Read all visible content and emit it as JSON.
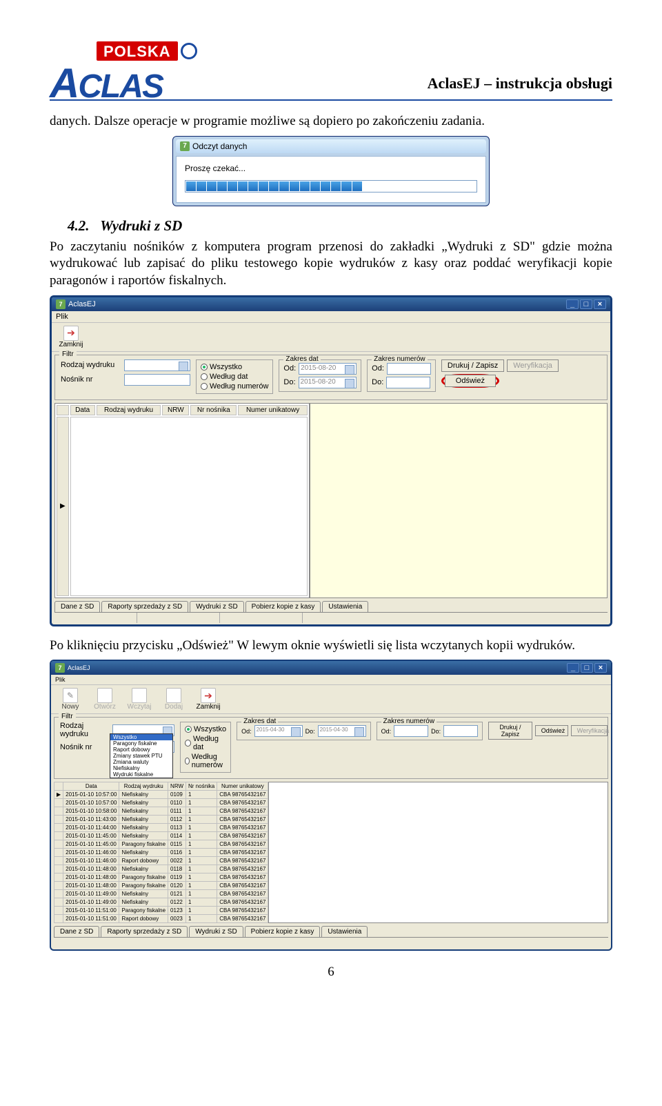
{
  "doc": {
    "header_title": "AclasEJ – instrukcja obsługi",
    "logo_polska": "POLSKA",
    "logo_aclas": "ACLAS",
    "para1": "danych. Dalsze operacje w programie możliwe są dopiero po zakończeniu zadania.",
    "section_no": "4.2.",
    "section_title": "Wydruki z SD",
    "para2": "Po zaczytaniu nośników z komputera program przenosi do zakładki „Wydruki z SD\" gdzie można wydrukować lub zapisać do pliku testowego kopie wydruków z kasy oraz poddać weryfikacji kopie paragonów i raportów fiskalnych.",
    "para3": "Po kliknięciu przycisku „Odśwież\" W lewym oknie wyświetli się lista wczytanych kopii wydruków.",
    "page_number": "6"
  },
  "progress_dialog": {
    "title": "Odczyt danych",
    "wait": "Proszę czekać...",
    "filled_segments": 17,
    "total_segments": 28
  },
  "app1": {
    "title": "AclasEJ",
    "menu_plik": "Plik",
    "tool_zamknij": "Zamknij",
    "filter_legend": "Filtr",
    "rodzaj_label": "Rodzaj wydruku",
    "nosnik_label": "Nośnik nr",
    "radio": {
      "wszystko": "Wszystko",
      "wedlug_dat": "Według dat",
      "wedlug_num": "Według numerów"
    },
    "zakres_dat": "Zakres dat",
    "zakres_num": "Zakres numerów",
    "od": "Od:",
    "do": "Do:",
    "date_from": "2015-08-20",
    "date_to": "2015-08-20",
    "btn_drukuj": "Drukuj / Zapisz",
    "btn_weryf": "Weryfikacja",
    "btn_odswiez": "Odśwież",
    "cols": {
      "data": "Data",
      "rodzaj": "Rodzaj wydruku",
      "nrw": "NRW",
      "nrnos": "Nr nośnika",
      "numunik": "Numer unikatowy"
    },
    "tabs": [
      "Dane z SD",
      "Raporty sprzedaży z SD",
      "Wydruki z SD",
      "Pobierz kopie z kasy",
      "Ustawienia"
    ]
  },
  "app2": {
    "title": "AclasEJ",
    "menu_plik": "Plik",
    "toolbar": {
      "nowy": "Nowy",
      "otworz": "Otwórz",
      "wczytaj": "Wczytaj",
      "dodaj": "Dodaj",
      "zamknij": "Zamknij"
    },
    "filter_legend": "Filtr",
    "rodzaj_label": "Rodzaj wydruku",
    "nosnik_label": "Nośnik nr",
    "radio": {
      "wszystko": "Wszystko",
      "wedlug_dat": "Według dat",
      "wedlug_num": "Według numerów"
    },
    "zakres_dat": "Zakres dat",
    "zakres_num": "Zakres numerów",
    "od": "Od:",
    "do": "Do:",
    "date_from": "2015-04-30",
    "date_to": "2015-04-30",
    "btn_drukuj": "Drukuj / Zapisz",
    "btn_odswiez": "Odśwież",
    "btn_weryf": "Weryfikacja",
    "cols": {
      "data": "Data",
      "rodzaj": "Rodzaj wydruku",
      "nrw": "NRW",
      "nrnos": "Nr nośnika",
      "numunik": "Numer unikatowy"
    },
    "dropdown_options": [
      "Wszystko",
      "Paragony fiskalne",
      "Raport dobowy",
      "Zmiany stawek PTU",
      "Zmiana waluty",
      "Niefiskalny",
      "Wydruki fiskalne"
    ],
    "rows": [
      {
        "data": "2015-01-10 10:57:00",
        "rodzaj": "Niefiskalny",
        "nrw": "0109",
        "nos": "1",
        "unik": "CBA 98765432167"
      },
      {
        "data": "2015-01-10 10:57:00",
        "rodzaj": "Niefiskalny",
        "nrw": "0110",
        "nos": "1",
        "unik": "CBA 98765432167"
      },
      {
        "data": "2015-01-10 10:58:00",
        "rodzaj": "Niefiskalny",
        "nrw": "0111",
        "nos": "1",
        "unik": "CBA 98765432167"
      },
      {
        "data": "2015-01-10 11:43:00",
        "rodzaj": "Niefiskalny",
        "nrw": "0112",
        "nos": "1",
        "unik": "CBA 98765432167"
      },
      {
        "data": "2015-01-10 11:44:00",
        "rodzaj": "Niefiskalny",
        "nrw": "0113",
        "nos": "1",
        "unik": "CBA 98765432167"
      },
      {
        "data": "2015-01-10 11:45:00",
        "rodzaj": "Niefiskalny",
        "nrw": "0114",
        "nos": "1",
        "unik": "CBA 98765432167"
      },
      {
        "data": "2015-01-10 11:45:00",
        "rodzaj": "Paragony fiskalne",
        "nrw": "0115",
        "nos": "1",
        "unik": "CBA 98765432167"
      },
      {
        "data": "2015-01-10 11:46:00",
        "rodzaj": "Niefiskalny",
        "nrw": "0116",
        "nos": "1",
        "unik": "CBA 98765432167"
      },
      {
        "data": "2015-01-10 11:46:00",
        "rodzaj": "Raport dobowy",
        "nrw": "0022",
        "nos": "1",
        "unik": "CBA 98765432167"
      },
      {
        "data": "2015-01-10 11:48:00",
        "rodzaj": "Niefiskalny",
        "nrw": "0118",
        "nos": "1",
        "unik": "CBA 98765432167"
      },
      {
        "data": "2015-01-10 11:48:00",
        "rodzaj": "Paragony fiskalne",
        "nrw": "0119",
        "nos": "1",
        "unik": "CBA 98765432167"
      },
      {
        "data": "2015-01-10 11:48:00",
        "rodzaj": "Paragony fiskalne",
        "nrw": "0120",
        "nos": "1",
        "unik": "CBA 98765432167"
      },
      {
        "data": "2015-01-10 11:49:00",
        "rodzaj": "Niefiskalny",
        "nrw": "0121",
        "nos": "1",
        "unik": "CBA 98765432167"
      },
      {
        "data": "2015-01-10 11:49:00",
        "rodzaj": "Niefiskalny",
        "nrw": "0122",
        "nos": "1",
        "unik": "CBA 98765432167"
      },
      {
        "data": "2015-01-10 11:51:00",
        "rodzaj": "Paragony fiskalne",
        "nrw": "0123",
        "nos": "1",
        "unik": "CBA 98765432167"
      },
      {
        "data": "2015-01-10 11:51:00",
        "rodzaj": "Raport dobowy",
        "nrw": "0023",
        "nos": "1",
        "unik": "CBA 98765432167"
      }
    ],
    "tabs": [
      "Dane z SD",
      "Raporty sprzedaży z SD",
      "Wydruki z SD",
      "Pobierz kopie z kasy",
      "Ustawienia"
    ]
  }
}
